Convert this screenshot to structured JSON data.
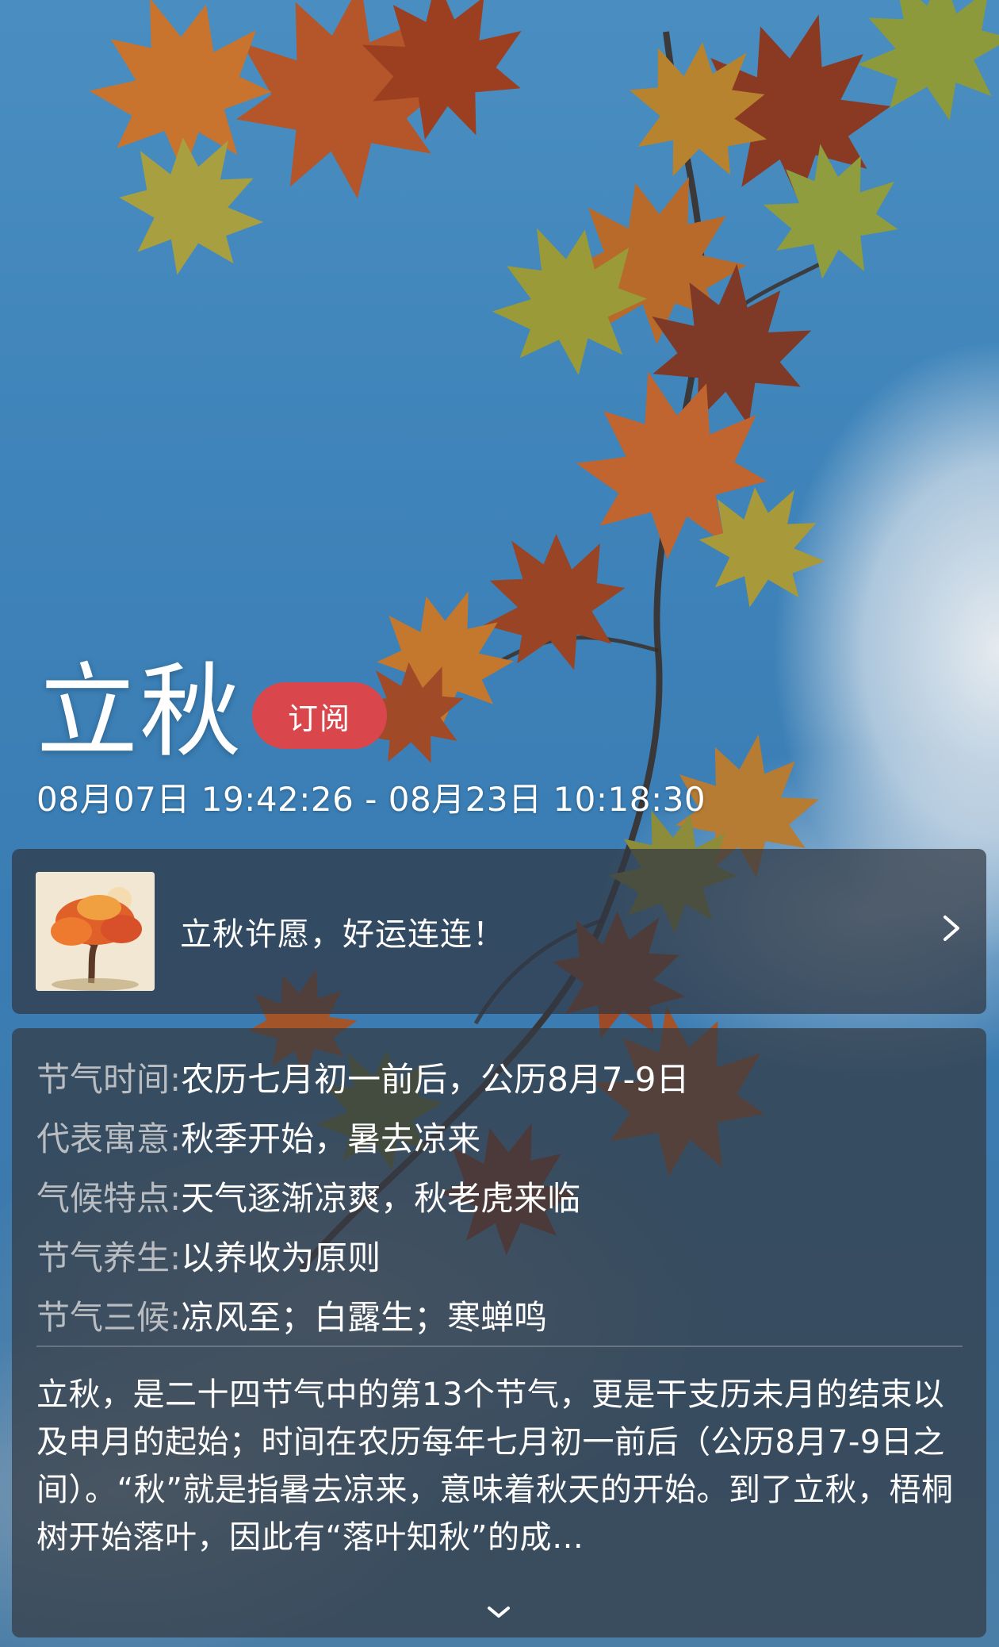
{
  "header": {
    "title": "立秋",
    "subscribe_label": "订阅",
    "date_range": "08月07日 19:42:26 - 08月23日 10:18:30"
  },
  "wish_card": {
    "text": "立秋许愿，好运连连！",
    "thumbnail_icon": "autumn-tree-icon",
    "chevron_icon": "chevron-right-icon"
  },
  "info": {
    "rows": [
      {
        "label": "节气时间:",
        "value": "农历七月初一前后，公历8月7-9日"
      },
      {
        "label": "代表寓意:",
        "value": "秋季开始，暑去凉来"
      },
      {
        "label": "气候特点:",
        "value": "天气逐渐凉爽，秋老虎来临"
      },
      {
        "label": "节气养生:",
        "value": "以养收为原则"
      },
      {
        "label": "节气三候:",
        "value": "凉风至；白露生；寒蝉鸣"
      }
    ],
    "description": "立秋，是二十四节气中的第13个节气，更是干支历未月的结束以及申月的起始；时间在农历每年七月初一前后（公历8月7-9日之间）。“秋”就是指暑去凉来，意味着秋天的开始。到了立秋，梧桐树开始落叶，因此有“落叶知秋”的成…",
    "expand_icon": "chevron-down-icon"
  },
  "colors": {
    "subscribe_button": "#d9474c",
    "sky": "#3e83b9",
    "card_background": "#343a42",
    "label_text": "#b9bdc2"
  }
}
